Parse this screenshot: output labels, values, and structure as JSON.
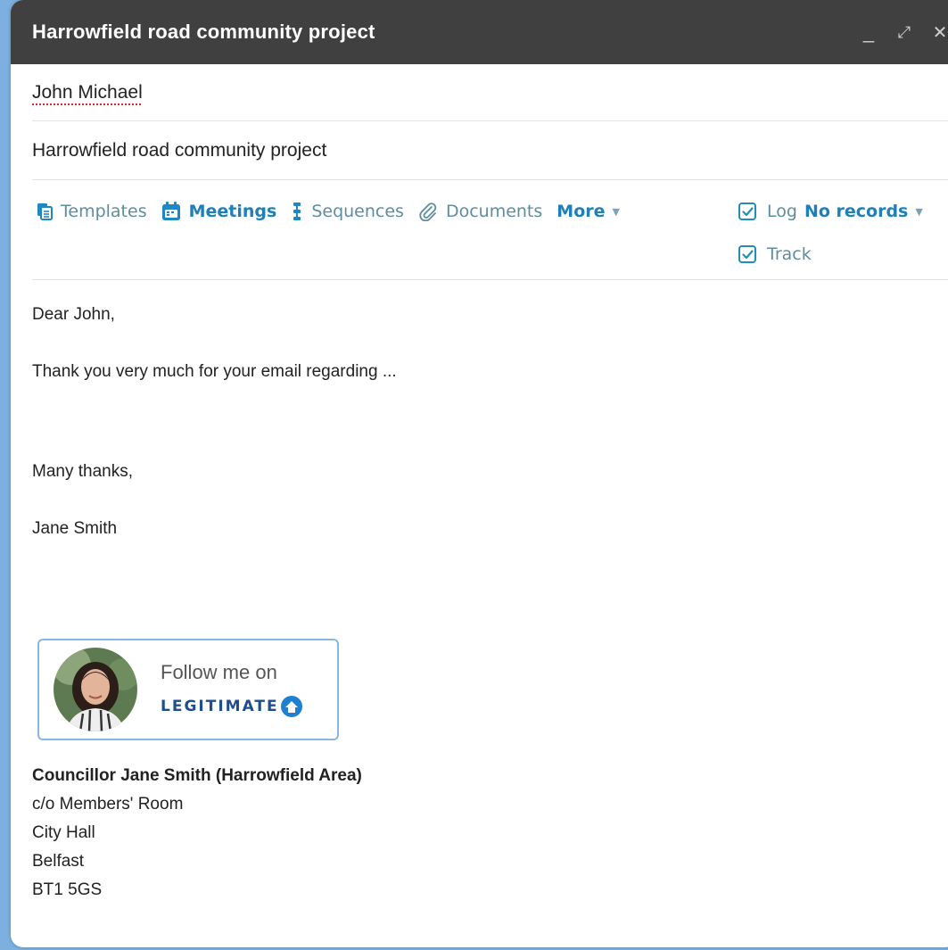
{
  "window": {
    "title": "Harrowfield road community project",
    "minimize_glyph": "_",
    "expand_glyph": "⤢",
    "close_glyph": "✕"
  },
  "to": {
    "recipient": "John Michael"
  },
  "subject": {
    "value": "Harrowfield road community project"
  },
  "toolbar": {
    "templates": "Templates",
    "meetings": "Meetings",
    "sequences": "Sequences",
    "documents": "Documents",
    "more": "More",
    "log_label": "Log",
    "log_records": "No records",
    "track_label": "Track",
    "log_checked": true,
    "track_checked": true
  },
  "body": {
    "greeting": "Dear John,",
    "line1": "Thank you very much for your email regarding ...",
    "closing": "Many thanks,",
    "sender": "Jane Smith"
  },
  "badge": {
    "follow_text": "Follow me on",
    "brand": "LEGITIMATE"
  },
  "signature": {
    "name": "Councillor Jane Smith (Harrowfield Area)",
    "line1": "c/o Members' Room",
    "line2": "City Hall",
    "line3": "Belfast",
    "line4": "BT1 5GS"
  },
  "colors": {
    "titlebar": "#404040",
    "accent": "#1f7fb7",
    "muted_link": "#5e8d9f",
    "badge_border": "#8ab7e2"
  },
  "icons": [
    "templates-icon",
    "meetings-icon",
    "sequences-icon",
    "documents-icon",
    "checkbox-checked-icon",
    "caret-down-icon",
    "avatar-photo",
    "legitimate-logo-icon"
  ]
}
